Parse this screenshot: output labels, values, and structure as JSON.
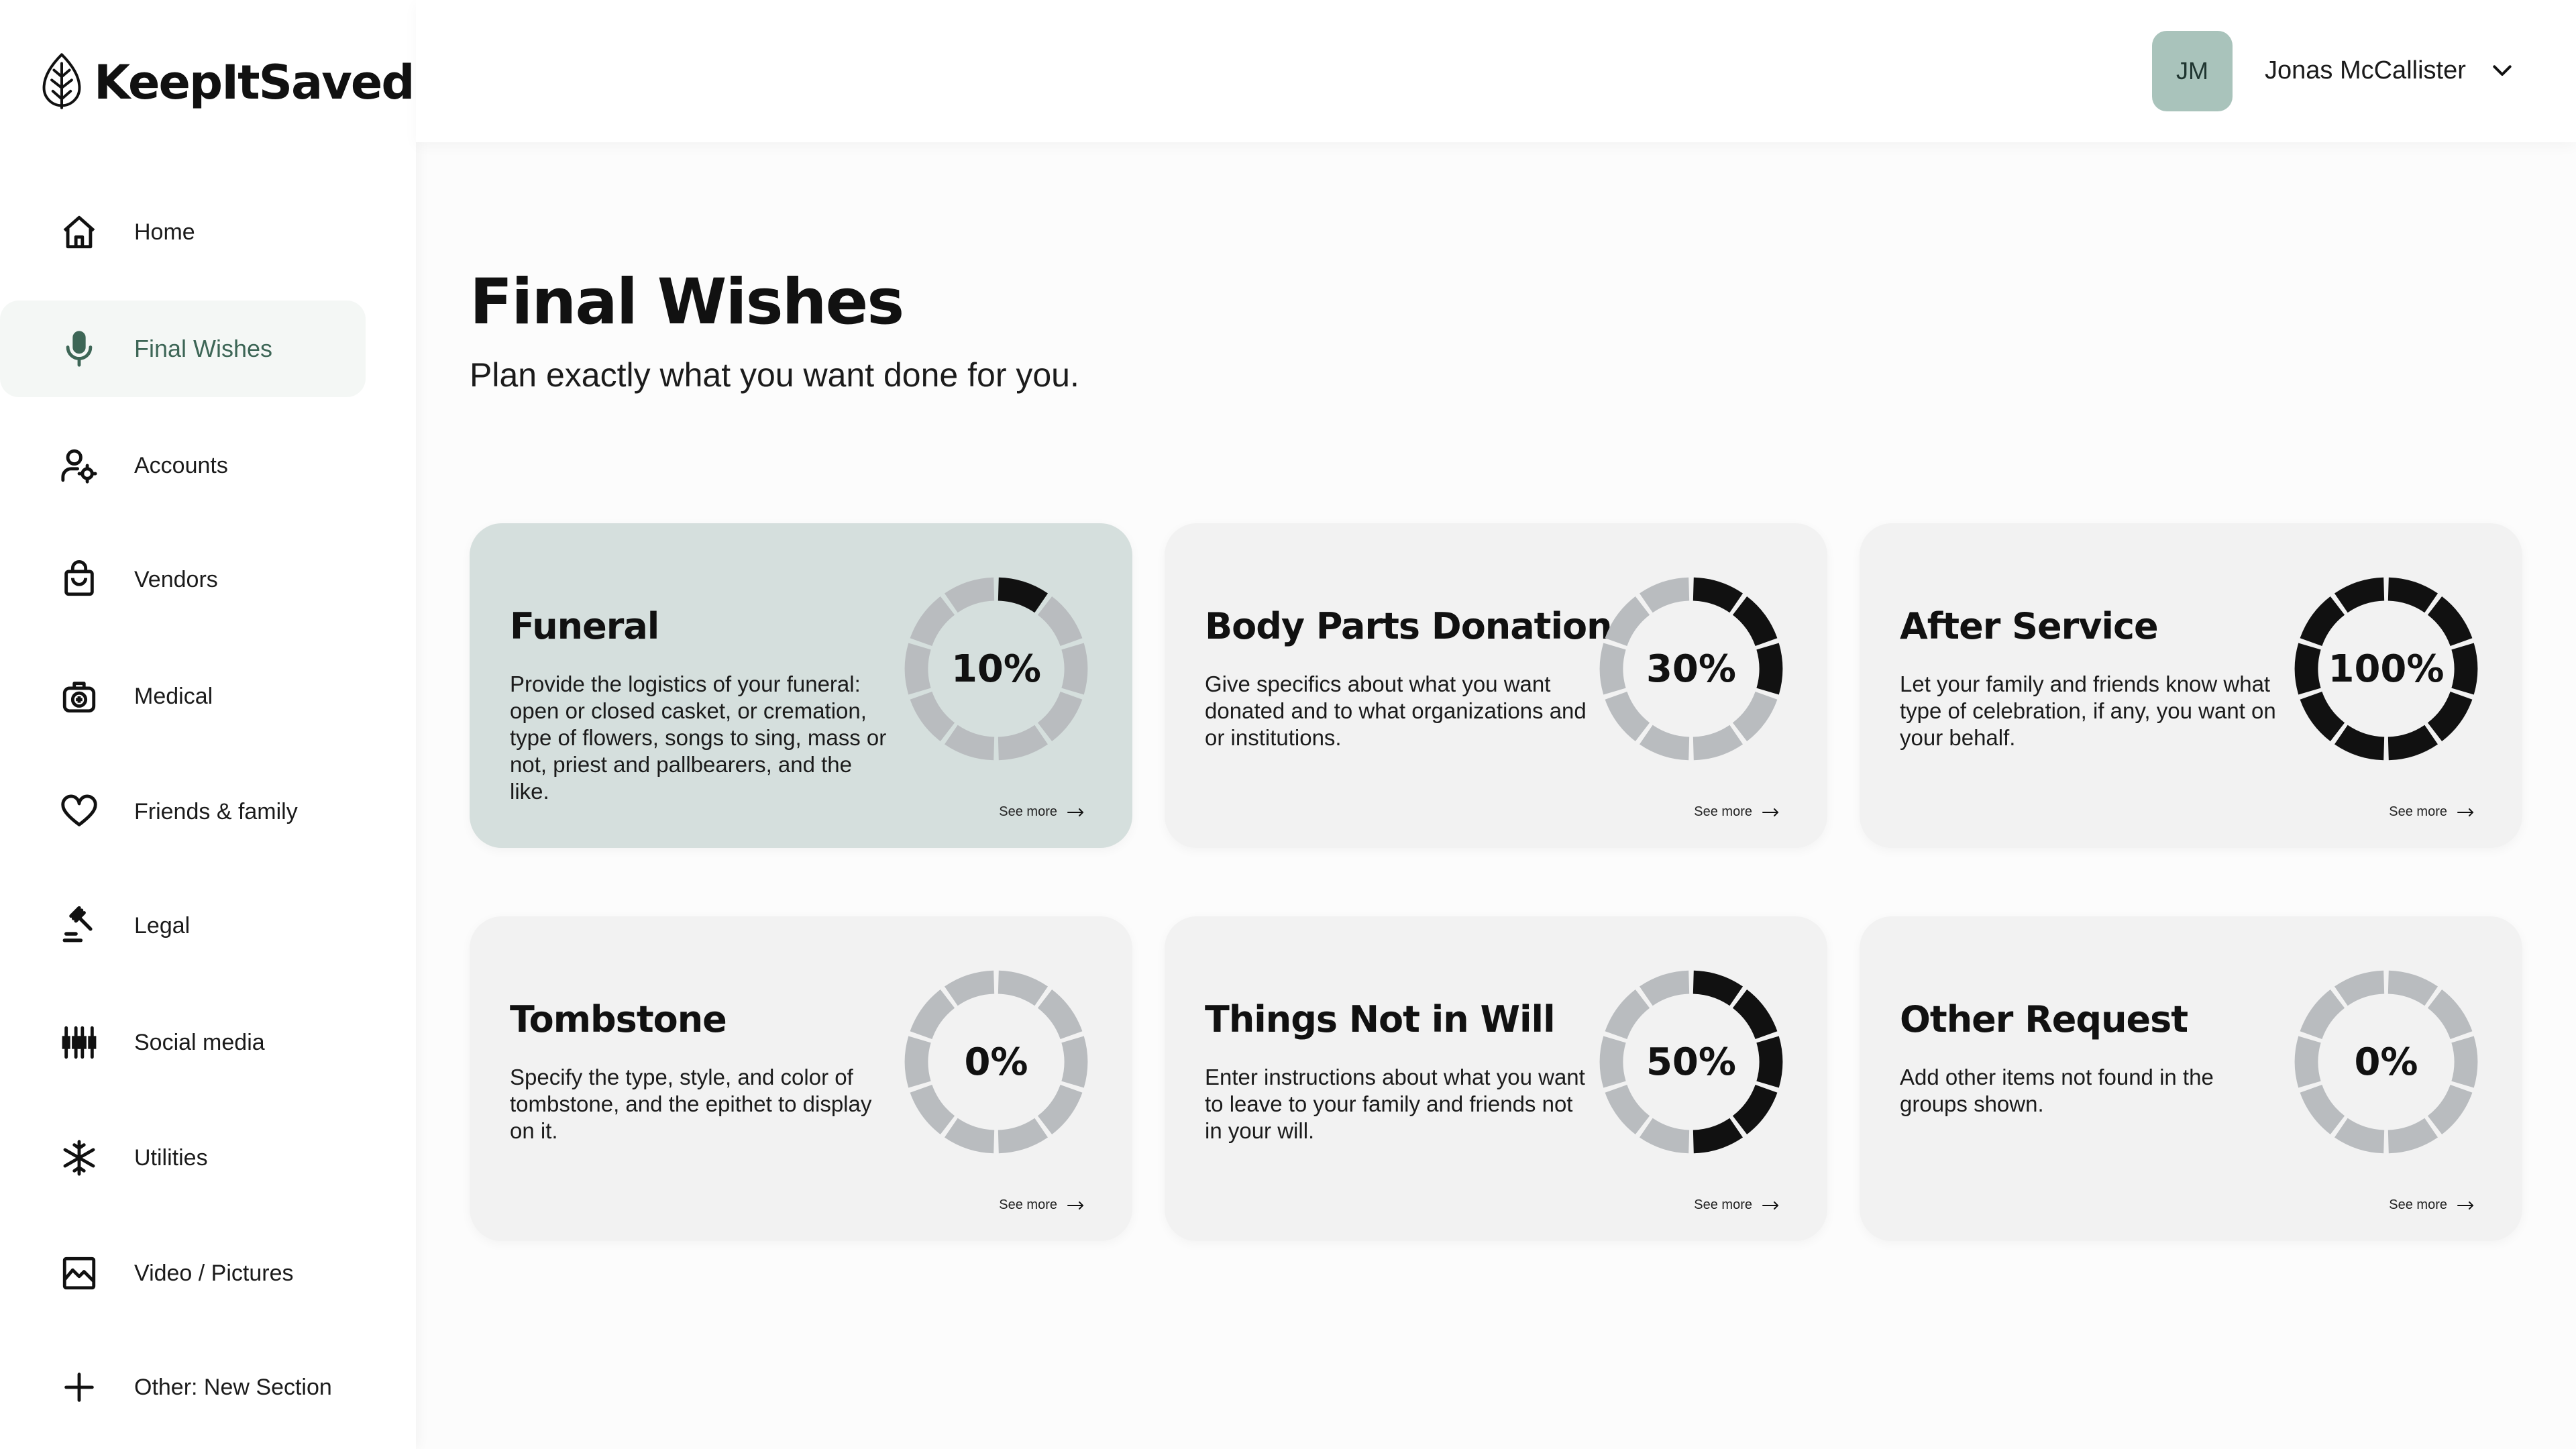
{
  "brand": {
    "name": "KeepItSaved"
  },
  "sidebar": {
    "items": [
      {
        "label": "Home",
        "icon": "home-icon",
        "active": false
      },
      {
        "label": "Final Wishes",
        "icon": "microphone-icon",
        "active": true
      },
      {
        "label": "Accounts",
        "icon": "users-icon",
        "active": false
      },
      {
        "label": "Vendors",
        "icon": "shopping-bag-icon",
        "active": false
      },
      {
        "label": "Medical",
        "icon": "medical-kit-icon",
        "active": false
      },
      {
        "label": "Friends & family",
        "icon": "heart-icon",
        "active": false
      },
      {
        "label": "Legal",
        "icon": "gavel-icon",
        "active": false
      },
      {
        "label": "Social media",
        "icon": "social-icon",
        "active": false
      },
      {
        "label": "Utilities",
        "icon": "snowflake-icon",
        "active": false
      },
      {
        "label": "Video / Pictures",
        "icon": "image-icon",
        "active": false
      },
      {
        "label": "Other: New Section",
        "icon": "plus-icon",
        "active": false
      }
    ]
  },
  "header": {
    "user": {
      "initials": "JM",
      "name": "Jonas McCallister"
    }
  },
  "main": {
    "title": "Final Wishes",
    "subtitle": "Plan exactly what you want done for you.",
    "cards": [
      {
        "title": "Funeral",
        "description": "Provide the logistics of your funeral: open or closed casket, or cremation, type of flowers, songs to sing, mass or not, priest and pallbearers, and the like.",
        "percent": 10,
        "percent_label": "10%",
        "link": "See more",
        "highlight": true
      },
      {
        "title": "Body Parts Donation",
        "description": "Give specifics about what you want donated and to what organizations and or institutions.",
        "percent": 30,
        "percent_label": "30%",
        "link": "See more",
        "highlight": false
      },
      {
        "title": "After Service",
        "description": "Let your family and friends know what type of celebration, if any, you want on your behalf.",
        "percent": 100,
        "percent_label": "100%",
        "link": "See more",
        "highlight": false
      },
      {
        "title": "Tombstone",
        "description": "Specify the type, style, and color of tombstone, and the epithet to display on it.",
        "percent": 0,
        "percent_label": "0%",
        "link": "See more",
        "highlight": false
      },
      {
        "title": "Things Not in Will",
        "description": "Enter instructions about what you want to leave to your family and friends not in your will.",
        "percent": 50,
        "percent_label": "50%",
        "link": "See more",
        "highlight": false
      },
      {
        "title": "Other Request",
        "description": "Add other items not found in the groups shown.",
        "percent": 0,
        "percent_label": "0%",
        "link": "See more",
        "highlight": false
      }
    ]
  },
  "colors": {
    "accent": "#3d6656",
    "active_bg": "#f4f7f5",
    "avatar_bg": "#a9c3bb",
    "card_bg": "#f2f2f2",
    "card_highlight_bg": "#d5dfdd",
    "donut_filled": "#111111",
    "donut_empty": "#b9bcbf"
  }
}
